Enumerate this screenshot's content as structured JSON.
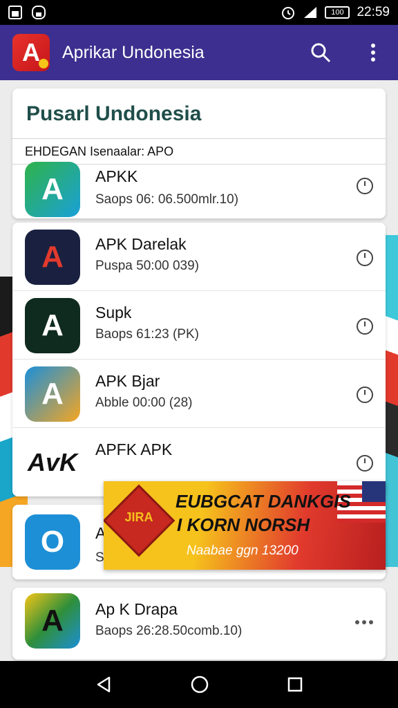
{
  "status_bar": {
    "time": "22:59",
    "battery": "100",
    "icons": [
      "gallery-icon",
      "download-icon",
      "alarm-icon",
      "signal-icon",
      "battery-icon"
    ]
  },
  "app_bar": {
    "title": "Aprikar Undonesia",
    "logo": "A",
    "actions": [
      "search-icon",
      "more-vert-icon"
    ]
  },
  "header_card": {
    "title": "Pusarl Undonesia",
    "subtitle": "EHDEGAN Isenaalar: APO"
  },
  "apps": [
    {
      "name": "APKK",
      "meta": "Saops 06: 06.500mlr.10)",
      "icon_bg": "#1aa0d8",
      "glyph": "A",
      "action": "timer-icon"
    },
    {
      "name": "APK Darelak",
      "meta": "Puspa 50:00 039)",
      "icon_bg": "#1a2040",
      "glyph": "A",
      "action": "timer-icon"
    },
    {
      "name": "Supk",
      "meta": "Baops 61:23 (PK)",
      "icon_bg": "#0f2a1e",
      "glyph": "A",
      "action": "timer-icon"
    },
    {
      "name": "APK Bjar",
      "meta": "Abble 00:00 (28)",
      "icon_bg": "#1b8fd9",
      "glyph": "A",
      "action": "timer-icon"
    },
    {
      "name": "APFK APK",
      "meta": "",
      "icon_bg": "#ffffff",
      "glyph": "AvK",
      "action": "timer-icon"
    },
    {
      "name": "A",
      "meta": "Sc",
      "icon_bg": "#1d8fd6",
      "glyph": "O",
      "action": ""
    },
    {
      "name": "Ap K Drapa",
      "meta": "Baops 26:28.50comb.10)",
      "icon_bg": "#2f8f3a",
      "glyph": "A",
      "action": "more-horiz-icon"
    }
  ],
  "banner": {
    "badge": "JIRA",
    "line1": "EUBGCAT DANKGIS",
    "line2": "I KORN NORSH",
    "line3": "Naabae ggn 13200"
  },
  "nav_bar": {
    "buttons": [
      "back-icon",
      "home-icon",
      "recents-icon"
    ]
  }
}
